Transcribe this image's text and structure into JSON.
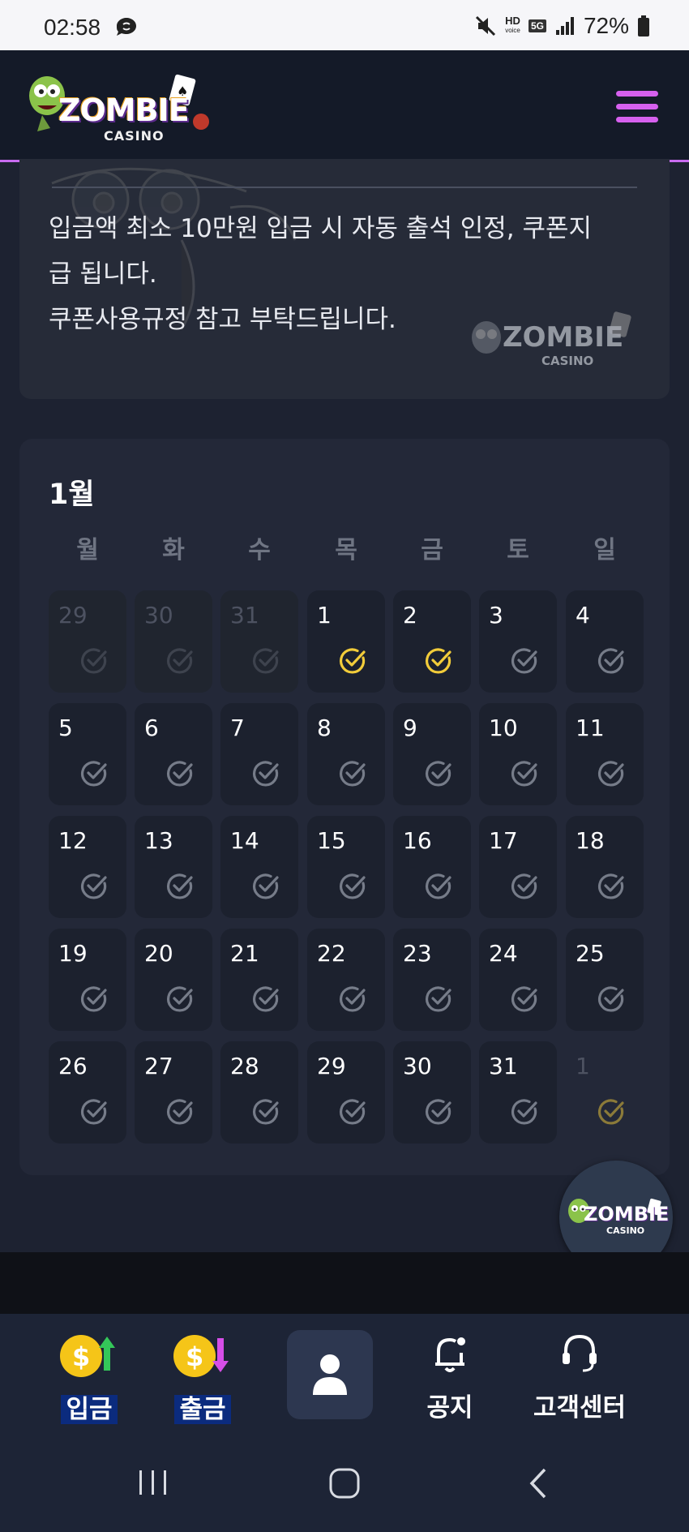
{
  "status_bar": {
    "time": "02:58",
    "battery": "72%",
    "icons": [
      "chat-bubble-icon",
      "mute-icon",
      "hd-voice-icon",
      "5g-icon",
      "signal-icon",
      "battery-icon"
    ],
    "hd_label": "HD",
    "voice_label": "voice",
    "network": "5G"
  },
  "header": {
    "logo_text": "ZOMBIE",
    "logo_subtext": "CASINO",
    "menu_icon": "hamburger-icon",
    "accent_color": "#d660ee"
  },
  "notice": {
    "lines": [
      "입금액 최소 10만원 입금 시 자동 출석 인정, 쿠폰지",
      "급 됩니다.",
      "쿠폰사용규정 참고 부탁드립니다."
    ],
    "logo_text": "ZOMBIE",
    "logo_subtext": "CASINO"
  },
  "calendar": {
    "month": "1월",
    "weekdays": [
      "월",
      "화",
      "수",
      "목",
      "금",
      "토",
      "일"
    ],
    "checked_color": "#f2cc3a",
    "unchecked_color": "#767c89",
    "days": [
      {
        "label": "29",
        "state": "prev"
      },
      {
        "label": "30",
        "state": "prev"
      },
      {
        "label": "31",
        "state": "prev"
      },
      {
        "label": "1",
        "state": "checked"
      },
      {
        "label": "2",
        "state": "checked"
      },
      {
        "label": "3",
        "state": "normal"
      },
      {
        "label": "4",
        "state": "normal"
      },
      {
        "label": "5",
        "state": "normal"
      },
      {
        "label": "6",
        "state": "normal"
      },
      {
        "label": "7",
        "state": "normal"
      },
      {
        "label": "8",
        "state": "normal"
      },
      {
        "label": "9",
        "state": "normal"
      },
      {
        "label": "10",
        "state": "normal"
      },
      {
        "label": "11",
        "state": "normal"
      },
      {
        "label": "12",
        "state": "normal"
      },
      {
        "label": "13",
        "state": "normal"
      },
      {
        "label": "14",
        "state": "normal"
      },
      {
        "label": "15",
        "state": "normal"
      },
      {
        "label": "16",
        "state": "normal"
      },
      {
        "label": "17",
        "state": "normal"
      },
      {
        "label": "18",
        "state": "normal"
      },
      {
        "label": "19",
        "state": "normal"
      },
      {
        "label": "20",
        "state": "normal"
      },
      {
        "label": "21",
        "state": "normal"
      },
      {
        "label": "22",
        "state": "normal"
      },
      {
        "label": "23",
        "state": "normal"
      },
      {
        "label": "24",
        "state": "normal"
      },
      {
        "label": "25",
        "state": "normal"
      },
      {
        "label": "26",
        "state": "normal"
      },
      {
        "label": "27",
        "state": "normal"
      },
      {
        "label": "28",
        "state": "normal"
      },
      {
        "label": "29",
        "state": "normal"
      },
      {
        "label": "30",
        "state": "normal"
      },
      {
        "label": "31",
        "state": "normal"
      },
      {
        "label": "1",
        "state": "next"
      }
    ]
  },
  "float_button": {
    "logo_text": "ZOMBIE",
    "logo_subtext": "CASINO"
  },
  "bottom_nav": {
    "deposit": "입금",
    "withdraw": "출금",
    "profile_icon": "user-icon",
    "notice": "공지",
    "support": "고객센터"
  },
  "android_nav": {
    "icons": [
      "recents-icon",
      "home-icon",
      "back-icon"
    ]
  }
}
